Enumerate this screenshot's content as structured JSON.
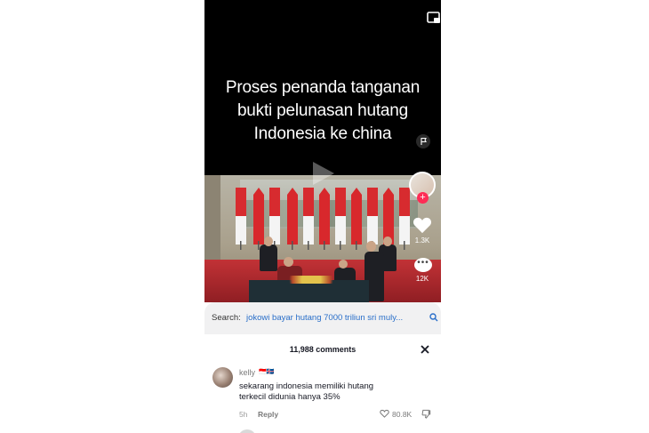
{
  "video": {
    "caption": "Proses penanda tanganan\nbukti pelunasan hutang\nIndonesia ke china"
  },
  "actions": {
    "like_count": "1.3K",
    "comment_count": "12K"
  },
  "search": {
    "label": "Search:",
    "query": "jokowi bayar hutang 7000 triliun sri muly..."
  },
  "comments": {
    "count_label": "11,988 comments",
    "items": [
      {
        "username": "kelly",
        "badges": "🇮🇩🇮🇸",
        "text": "sekarang indonesia memiliki hutang terkecil didunia hanya 35%",
        "time": "5h",
        "reply_label": "Reply",
        "likes": "80.8K"
      }
    ]
  },
  "colors": {
    "accent": "#fe2c55",
    "link": "#2a6fc9",
    "flag_china": "#d8282c",
    "flag_indonesia_red": "#d72b2f"
  },
  "icons": {
    "pip": "pip-icon",
    "flag": "flag-icon",
    "play": "play-icon",
    "like": "heart-icon",
    "comment": "comment-icon",
    "search": "search-icon",
    "close": "close-icon",
    "dislike": "dislike-icon"
  }
}
